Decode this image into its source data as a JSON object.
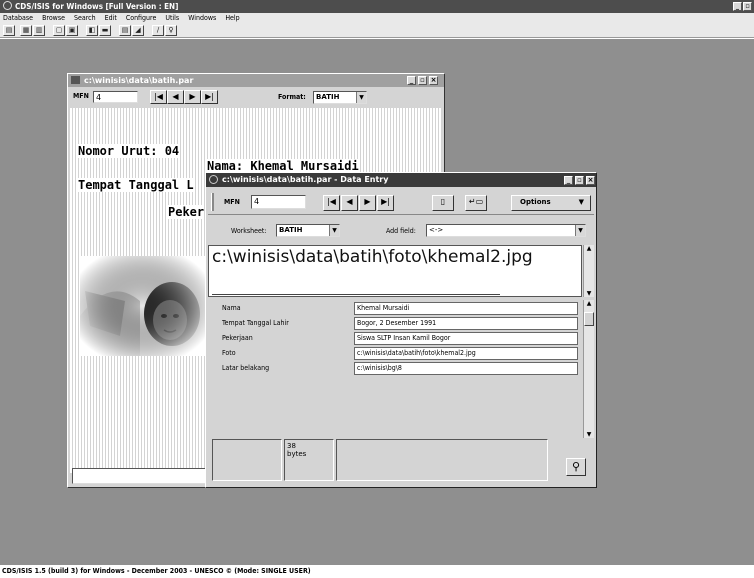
{
  "app": {
    "title": "CDS/ISIS for Windows [Full Version : EN]",
    "status_bar": "CDS/ISIS 1.5 (build 3) for Windows - December 2003 - UNESCO © (Mode: SINGLE USER)"
  },
  "menu": [
    "Database",
    "Browse",
    "Search",
    "Edit",
    "Configure",
    "Utils",
    "Windows",
    "Help"
  ],
  "toolbar_icons": [
    "open-database-icon",
    "save-icon",
    "print-setup-icon",
    "copy-icon",
    "replace-icon",
    "preview-icon",
    "print-icon",
    "index-icon",
    "edit-icon",
    "pencil-icon",
    "search-bulb-icon"
  ],
  "browse_window": {
    "title": "c:\\winisis\\data\\batih.par",
    "mfn_label": "MFN",
    "mfn_value": "4",
    "format_label": "Format:",
    "format_value": "BATIH",
    "nav": [
      "|◀",
      "◀",
      "▶",
      "▶|"
    ],
    "record_lines": {
      "nomor": "Nomor Urut: 04",
      "nama": "Nama: Khemal Mursaidi",
      "tempat": "Tempat Tanggal L",
      "pekerjaan": "Peker"
    }
  },
  "entry_window": {
    "title": "c:\\winisis\\data\\batih.par - Data Entry",
    "mfn_label": "MFN",
    "mfn_value": "4",
    "options_label": "Options",
    "worksheet_label": "Worksheet:",
    "worksheet_value": "BATIH",
    "add_field_label": "Add field:",
    "add_field_value": "<->",
    "current_field_text": "c:\\winisis\\data\\batih\\foto\\khemal2.jpg",
    "fields": [
      {
        "label": "Nama",
        "value": "Khemal Mursaidi"
      },
      {
        "label": "Tempat Tanggal Lahir",
        "value": "Bogor, 2 Desember 1991"
      },
      {
        "label": "Pekerjaan",
        "value": "Siswa SLTP Insan Kamil Bogor"
      },
      {
        "label": "Foto",
        "value": "c:\\winisis\\data\\batih\\foto\\khemal2.jpg"
      },
      {
        "label": "Latar belakang",
        "value": "c:\\winisis\\bg\\8"
      }
    ],
    "size_value": "38",
    "size_unit": "bytes"
  }
}
